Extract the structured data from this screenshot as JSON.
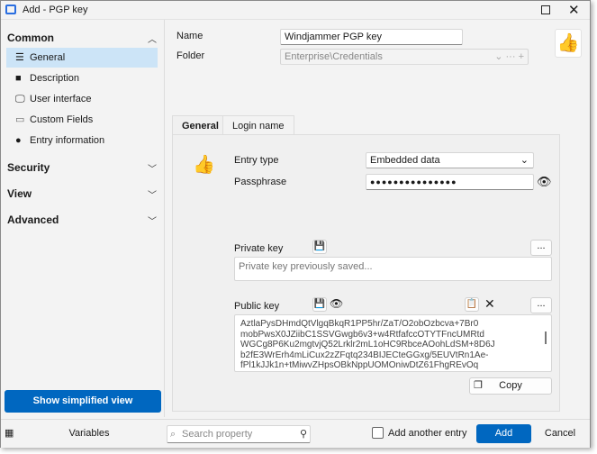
{
  "window": {
    "title": "Add - PGP key",
    "icons": [
      "app-icon",
      "maximize-icon",
      "close-icon"
    ]
  },
  "sidebar": {
    "sections": [
      {
        "label": "Common",
        "expanded": true,
        "items": [
          {
            "label": "General",
            "icon": "list-icon",
            "selected": true
          },
          {
            "label": "Description",
            "icon": "document-icon"
          },
          {
            "label": "User interface",
            "icon": "monitor-icon"
          },
          {
            "label": "Custom Fields",
            "icon": "edit-field-icon"
          },
          {
            "label": "Entry information",
            "icon": "info-icon"
          }
        ]
      },
      {
        "label": "Security",
        "expanded": false
      },
      {
        "label": "View",
        "expanded": false
      },
      {
        "label": "Advanced",
        "expanded": false
      }
    ],
    "simplified_button": "Show simplified view"
  },
  "form": {
    "name_label": "Name",
    "name_value": "Windjammer PGP key",
    "folder_label": "Folder",
    "folder_value": "Enterprise\\Credentials"
  },
  "tabs": [
    {
      "label": "General",
      "active": true
    },
    {
      "label": "Login name",
      "active": false
    }
  ],
  "general": {
    "entry_type_label": "Entry type",
    "entry_type_value": "Embedded data",
    "passphrase_label": "Passphrase",
    "passphrase_value": "●●●●●●●●●●●●●●●",
    "private_key_label": "Private key",
    "private_key_placeholder": "Private key previously saved...",
    "public_key_label": "Public key",
    "public_key_lines": [
      "AztlaPysDHmdQtVlgqBkqR1PP5hr/ZaT/O2obOzbcva+7Br0",
      "mobPwsX0JZiibC1SSVGwgb6v3+w4RtfafccOTYTFncUMRtd",
      "WGCg8P6Ku2mgtvjQ52Lrklr2mL1oHC9RbceAOohLdSM+8D6J",
      "b2fE3WrErh4mLiCux2zZFqtq234BIJECteGGxg/5EUVtRn1Ae-",
      "fPl1kJJk1n+tMiwvZHpsOBkNppUOMOniwDtZ61FhgREvOq"
    ],
    "ellipsis": "...",
    "copy_label": "Copy"
  },
  "bottom": {
    "variables_label": "Variables",
    "search_placeholder": "Search property",
    "add_another_label": "Add another entry",
    "add_label": "Add",
    "cancel_label": "Cancel"
  },
  "colors": {
    "accent": "#0067c0",
    "selected": "#cce4f7",
    "icon_orange": "#f47c20",
    "icon_blue": "#1a5fa8"
  }
}
